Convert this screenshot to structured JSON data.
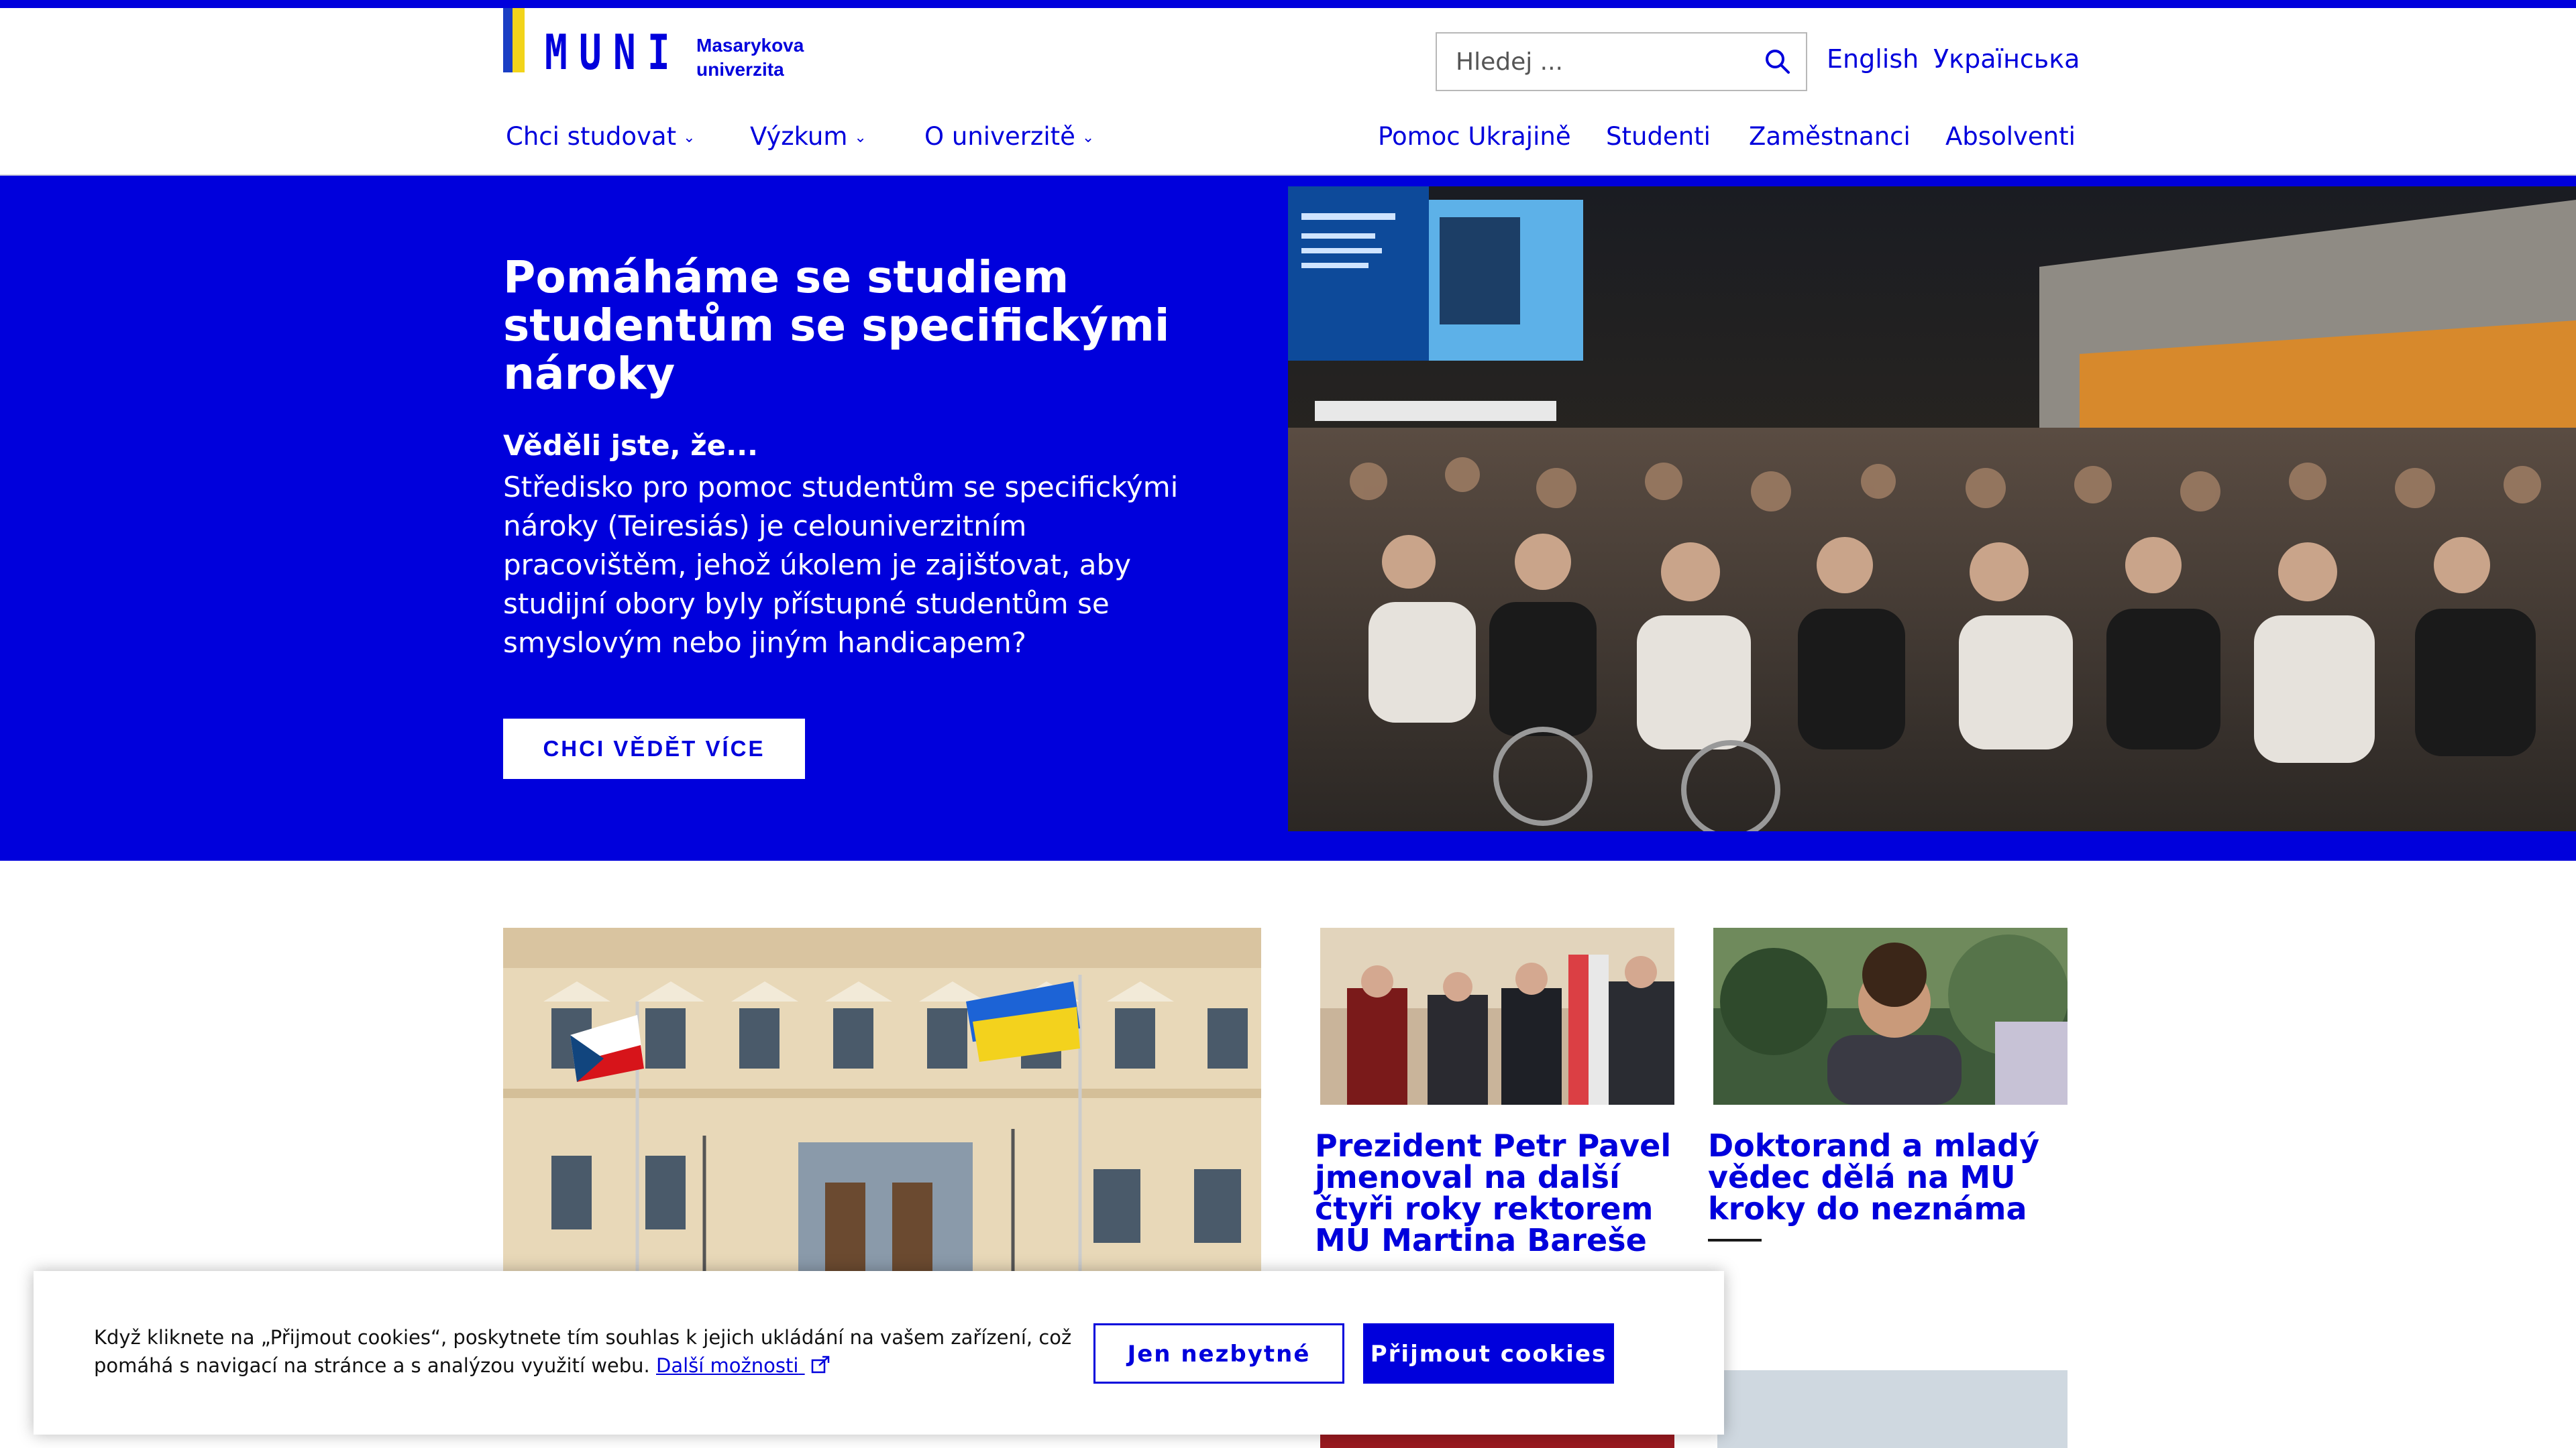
{
  "header": {
    "logo_text": "MUNI",
    "logo_name_line1": "Masarykova",
    "logo_name_line2": "univerzita",
    "search_placeholder": "Hledej ...",
    "languages": [
      "English",
      "Українська"
    ]
  },
  "nav": {
    "main": [
      "Chci studovat",
      "Výzkum",
      "O univerzitě"
    ],
    "right": [
      "Pomoc Ukrajině",
      "Studenti",
      "Zaměstnanci",
      "Absolventi"
    ]
  },
  "hero": {
    "title": "Pomáháme se studiem studentům se specifickými nároky",
    "subtitle": "Věděli jste, že...",
    "text": "Středisko pro pomoc studentům se specifickými nároky (Teiresiás) je celouniverzitním pracovištěm, jehož úkolem je zajišťovat, aby studijní obory byly přístupné studentům se smyslovým nebo jiným handicapem?",
    "button": "CHCI VĚDĚT VÍCE",
    "photo_icon": "conference-hall-photo"
  },
  "news": [
    {
      "title": "Prezident Petr Pavel jmenoval na další čtyři roky rektorem MU Martina Bareše",
      "image": "inauguration-photo"
    },
    {
      "title": "Doktorand a mladý vědec dělá na MU kroky do neznáma",
      "image": "portrait-photo"
    }
  ],
  "main_news_image": "university-building-photo",
  "cookie": {
    "text": "Když kliknete na „Přijmout cookies“, poskytnete tím souhlas k jejich ukládání na vašem zařízení, což pomáhá s navigací na stránce a s analýzou využití webu.",
    "link": "Další možnosti",
    "btn_essential": "Jen nezbytné",
    "btn_accept": "Přijmout cookies"
  },
  "colors": {
    "brand": "#0000dc",
    "white": "#ffffff"
  }
}
